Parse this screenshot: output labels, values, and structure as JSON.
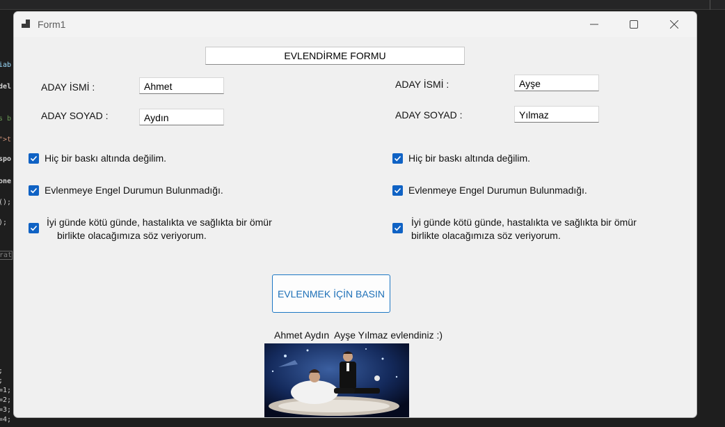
{
  "background_code": [
    "iab",
    "del",
    "s b",
    "\">t",
    "spo",
    "one",
    "();",
    ");",
    "rat",
    ";",
    ";",
    "=1;",
    "=2;",
    "=3;",
    "=4;"
  ],
  "window": {
    "title": "Form1"
  },
  "icons": {
    "app": "app-icon",
    "minimize": "minimize-icon",
    "maximize": "maximize-icon",
    "close": "close-icon",
    "check": "checkmark-icon"
  },
  "form": {
    "header": "EVLENDİRME FORMU",
    "left": {
      "name_label": "ADAY İSMİ  :",
      "name_value": "Ahmet",
      "surname_label": "ADAY SOYAD :",
      "surname_value": "Aydın",
      "checks": [
        {
          "checked": true,
          "lines": [
            "Hiç bir baskı altında değilim."
          ]
        },
        {
          "checked": true,
          "lines": [
            "Evlenmeye Engel Durumun Bulunmadığı."
          ]
        },
        {
          "checked": true,
          "lines": [
            "İyi günde kötü günde, hastalıkta ve sağlıkta bir ömür",
            "birlikte olacağımıza söz veriyorum."
          ]
        }
      ]
    },
    "right": {
      "name_label": "ADAY İSMİ :",
      "name_value": "Ayşe",
      "surname_label": "ADAY SOYAD :",
      "surname_value": "Yılmaz",
      "checks": [
        {
          "checked": true,
          "lines": [
            "Hiç bir baskı altında değilim."
          ]
        },
        {
          "checked": true,
          "lines": [
            "Evlenmeye Engel Durumun Bulunmadığı."
          ]
        },
        {
          "checked": true,
          "lines": [
            "İyi günde kötü günde, hastalıkta ve sağlıkta bir ömür",
            "birlikte olacağımıza söz veriyorum."
          ]
        }
      ]
    },
    "button_label": "EVLENMEK İÇİN BASIN",
    "result_text": "Ahmet Aydın  Ayşe Yılmaz evlendiniz :)"
  },
  "colors": {
    "accent": "#0f62c4",
    "button_border": "#1c77c4",
    "button_text": "#1c6fb7",
    "form_bg": "#f0f0f0"
  }
}
